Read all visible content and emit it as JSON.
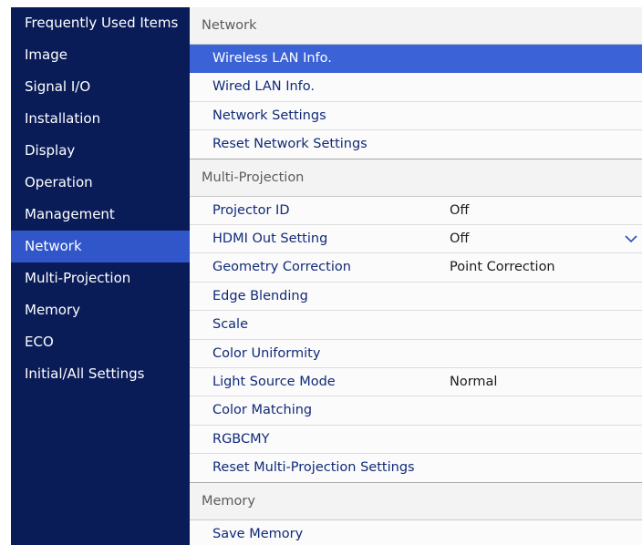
{
  "sidebar": {
    "items": [
      {
        "label": "Frequently Used Items"
      },
      {
        "label": "Image"
      },
      {
        "label": "Signal I/O"
      },
      {
        "label": "Installation"
      },
      {
        "label": "Display"
      },
      {
        "label": "Operation"
      },
      {
        "label": "Management"
      },
      {
        "label": "Network",
        "active": true
      },
      {
        "label": "Multi-Projection"
      },
      {
        "label": "Memory"
      },
      {
        "label": "ECO"
      },
      {
        "label": "Initial/All Settings"
      }
    ]
  },
  "content": {
    "network_section": "Network",
    "network_items": [
      {
        "label": "Wireless LAN Info."
      },
      {
        "label": "Wired LAN Info."
      },
      {
        "label": "Network Settings"
      },
      {
        "label": "Reset Network Settings"
      }
    ],
    "multi_section": "Multi-Projection",
    "multi_items": [
      {
        "label": "Projector ID",
        "value": "Off"
      },
      {
        "label": "HDMI Out Setting",
        "value": "Off"
      },
      {
        "label": "Geometry Correction",
        "value": "Point Correction"
      },
      {
        "label": "Edge Blending"
      },
      {
        "label": "Scale"
      },
      {
        "label": "Color Uniformity"
      },
      {
        "label": "Light Source Mode",
        "value": "Normal"
      },
      {
        "label": "Color Matching"
      },
      {
        "label": "RGBCMY"
      },
      {
        "label": "Reset Multi-Projection Settings"
      }
    ],
    "memory_section": "Memory",
    "memory_items": [
      {
        "label": "Save Memory"
      }
    ]
  },
  "icons": {
    "dropdown": "chevron-down-icon"
  },
  "colors": {
    "sidebar_bg": "#0a1c58",
    "sidebar_active": "#3056c9",
    "selected_row": "#3b62d6",
    "menu_text": "#102a78"
  }
}
